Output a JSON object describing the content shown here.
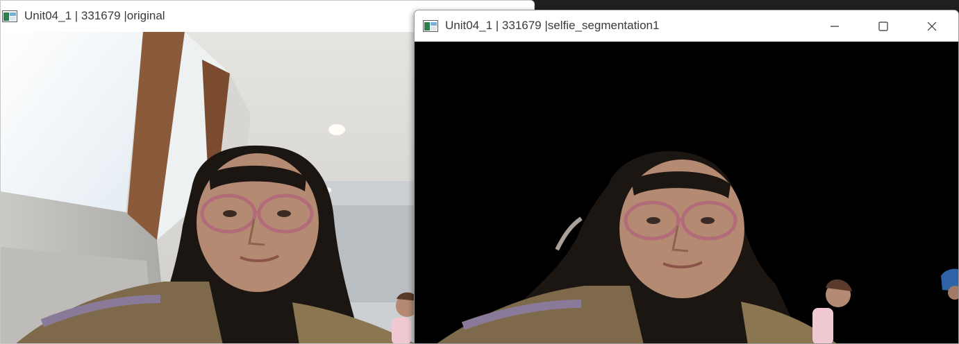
{
  "windows": {
    "original": {
      "title": "Unit04_1 | 331679 |original",
      "icon": "opencv-window-icon"
    },
    "segmentation": {
      "title": "Unit04_1 | 331679 |selfie_segmentation1",
      "icon": "opencv-window-icon",
      "controls": {
        "minimize": "minimize-icon",
        "maximize": "maximize-icon",
        "close": "close-icon"
      },
      "background_color": "#000000"
    }
  }
}
